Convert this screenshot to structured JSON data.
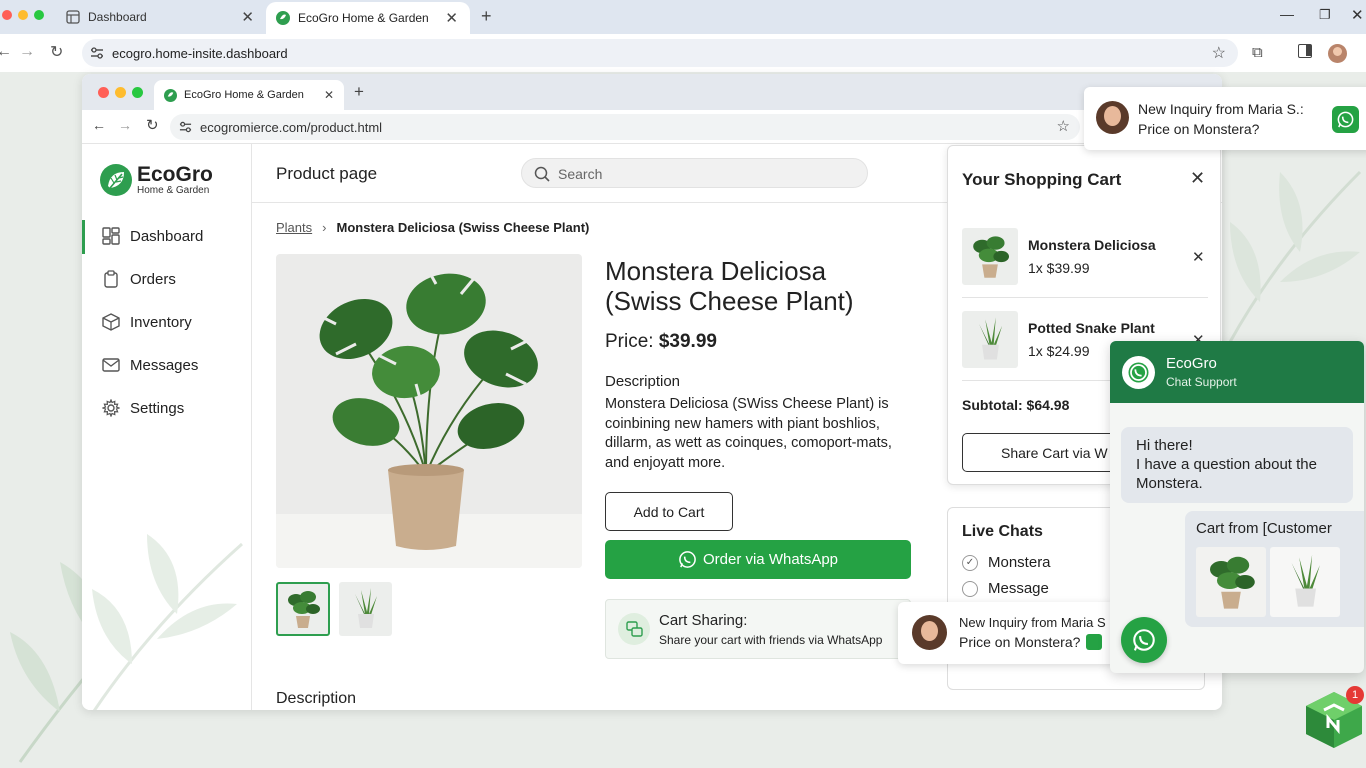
{
  "outer_browser": {
    "tabs": [
      {
        "label": "Dashboard",
        "icon": "dashboard-icon"
      },
      {
        "label": "EcoGro Home & Garden",
        "icon": "ecogro-favicon"
      }
    ],
    "url": "ecogro.home-insite.dashboard"
  },
  "inner_browser": {
    "tab_label": "EcoGro Home & Garden",
    "url": "ecogromierce.com/product.html"
  },
  "brand": {
    "name": "EcoGro",
    "tagline": "Home & Garden",
    "color": "#2e9e4f"
  },
  "sidebar": {
    "items": [
      {
        "label": "Dashboard",
        "icon": "dashboard-icon",
        "active": true
      },
      {
        "label": "Orders",
        "icon": "clipboard-icon"
      },
      {
        "label": "Inventory",
        "icon": "box-icon"
      },
      {
        "label": "Messages",
        "icon": "mail-icon"
      },
      {
        "label": "Settings",
        "icon": "gear-icon"
      }
    ]
  },
  "header": {
    "title": "Product page",
    "search_placeholder": "Search"
  },
  "breadcrumb": {
    "parent": "Plants",
    "current": "Monstera Deliciosa (Swiss Cheese Plant)"
  },
  "product": {
    "title_line1": "Monstera Deliciosa",
    "title_line2": "(Swiss Cheese Plant)",
    "price_label": "Price:",
    "price": "$39.99",
    "description_heading": "Description",
    "description_lines": [
      "Monstera Deliciosa (SWiss Cheese Plant) is",
      "coinbining new hamers with piant boshlios,",
      "dillarm, as wett as coinques, comoport-mats,",
      "and enjoyatt more."
    ],
    "add_to_cart_label": "Add to Cart",
    "whatsapp_order_label": "Order via WhatsApp",
    "bottom_description_heading": "Description"
  },
  "cart_sharing": {
    "title": "Cart Sharing:",
    "subtitle": "Share your cart with friends via WhatsApp"
  },
  "cart": {
    "title": "Your Shopping Cart",
    "items": [
      {
        "name": "Monstera Deliciosa",
        "qty_price": "1x $39.99"
      },
      {
        "name": "Potted Snake Plant",
        "qty_price": "1x $24.99"
      }
    ],
    "subtotal": "Subtotal: $64.98",
    "share_button": "Share Cart via W"
  },
  "live_chats": {
    "title": "Live Chats",
    "items": [
      {
        "label": "Monstera",
        "checked": true
      },
      {
        "label": "Message",
        "checked": false
      }
    ]
  },
  "notification_top": {
    "title": "New Inquiry from Maria S.:",
    "body": "Price on Monstera?"
  },
  "notification_mid": {
    "title": "New Inquiry from Maria S",
    "body": "Price on Monstera?"
  },
  "chat": {
    "name": "EcoGro",
    "subtitle": "Chat Support",
    "incoming": [
      "Hi there!",
      "I have a question about the",
      "Monstera."
    ],
    "outgoing_title": "Cart from [Customer",
    "header_color": "#1f7a45",
    "whatsapp_color": "#25a244"
  },
  "badge_count": "1"
}
